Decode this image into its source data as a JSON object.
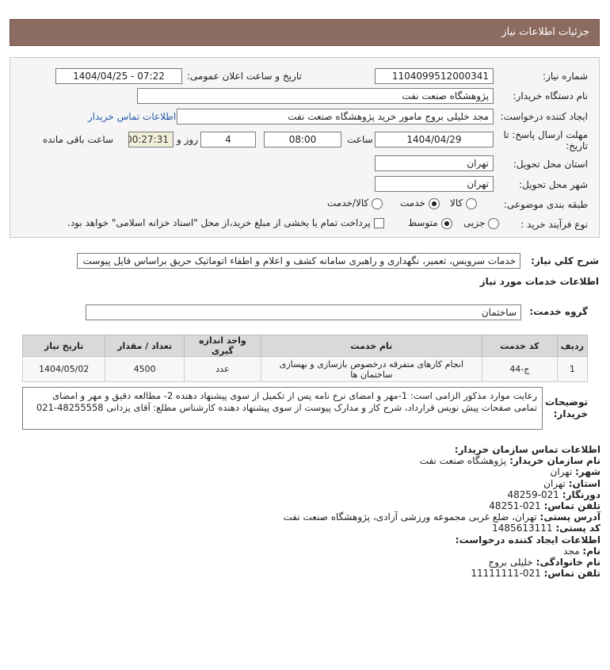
{
  "header": {
    "title": "جزئیات اطلاعات نیاز"
  },
  "fields": {
    "need_number_label": "شماره نیاز:",
    "need_number": "1104099512000341",
    "announce_label": "تاریخ و ساعت اعلان عمومی:",
    "announce_value": "1404/04/25 - 07:22",
    "buyer_org_label": "نام دستگاه خریدار:",
    "buyer_org": "پژوهشگاه صنعت نفت",
    "requester_label": "ایجاد کننده درخواست:",
    "requester": "مجد خلیلی بروج مامور خرید پژوهشگاه صنعت نفت",
    "buyer_contact_link": "اطلاعات تماس خریدار",
    "deadline_label_line1": "مهلت ارسال پاسخ: تا",
    "deadline_label_line2": "تاریخ:",
    "deadline_date": "1404/04/29",
    "time_label": "ساعت",
    "deadline_time": "08:00",
    "days_value": "4",
    "days_label": "روز و",
    "remaining_time": "00:27:31",
    "remaining_label": "ساعت باقی مانده",
    "province_label": "استان محل تحویل:",
    "province": "تهران",
    "city_label": "شهر محل تحویل:",
    "city": "تهران",
    "category_label": "طبقه بندی موضوعی:",
    "category_options": [
      "کالا",
      "خدمت",
      "کالا/خدمت"
    ],
    "category_selected": "خدمت",
    "process_label": "نوع فرآیند خرید :",
    "process_options": [
      "جزیی",
      "متوسط"
    ],
    "process_selected": "متوسط",
    "payment_note": "پرداخت تمام یا بخشی از مبلغ خرید،از محل \"اسناد خزانه اسلامی\" خواهد بود."
  },
  "description": {
    "label": "شرح کلي نياز:",
    "text": "خدمات سرویس، تعمیر، نگهداری و راهبری سامانه کشف و اعلام و اطفاء اتوماتیک حریق براساس فایل پیوست",
    "services_heading": "اطلاعات خدمات مورد نیاز",
    "service_group_label": "گروه خدمت:",
    "service_group": "ساختمان"
  },
  "table": {
    "headers": [
      "ردیف",
      "کد خدمت",
      "نام خدمت",
      "واحد اندازه گیری",
      "تعداد / مقدار",
      "تاریخ نیاز"
    ],
    "rows": [
      [
        "1",
        "ج-44",
        "انجام کارهای متفرقه درخصوص بازسازی و بهسازی ساختمان ها",
        "عدد",
        "4500",
        "1404/05/02"
      ]
    ]
  },
  "buyer_notes": {
    "label": "توضیحات خریدار:",
    "text": "رعایت موارد مذکور الزامی است: 1-مهر و امضای نرخ نامه پس از تکمیل از سوی پیشنهاد دهنده 2- مطالعه دقیق و مهر و امضای تمامی صفحات پیش نویس قرارداد، شرح کار و مدارک پیوست از سوی پیشنهاد دهنده کارشناس مطلع: آقای یزدانی 48255558-021"
  },
  "contact": {
    "title": "اطلاعات تماس سازمان خریدار:",
    "org_label": "نام سازمان خریدار:",
    "org": "پژوهشگاه صنعت نفت",
    "city_label": "شهر:",
    "city": "تهران",
    "province_label": "استان:",
    "province": "تهران",
    "fax_label": "دورنگار:",
    "fax": "021-48259",
    "phone_label": "تلفن تماس:",
    "phone": "021-48251",
    "address_label": "آدرس پستی:",
    "address": "تهران، ضلع غربی مجموعه ورزشی آزادی، پژوهشگاه صنعت نفت",
    "postal_label": "کد پستی:",
    "postal": "1485613111",
    "creator_title": "اطلاعات ایجاد کننده درخواست:",
    "name_label": "نام:",
    "name": "مجد",
    "family_label": "نام خانوادگی:",
    "family": "خلیلی بروج",
    "creator_phone_label": "تلفن تماس:",
    "creator_phone": "021-11111111"
  }
}
